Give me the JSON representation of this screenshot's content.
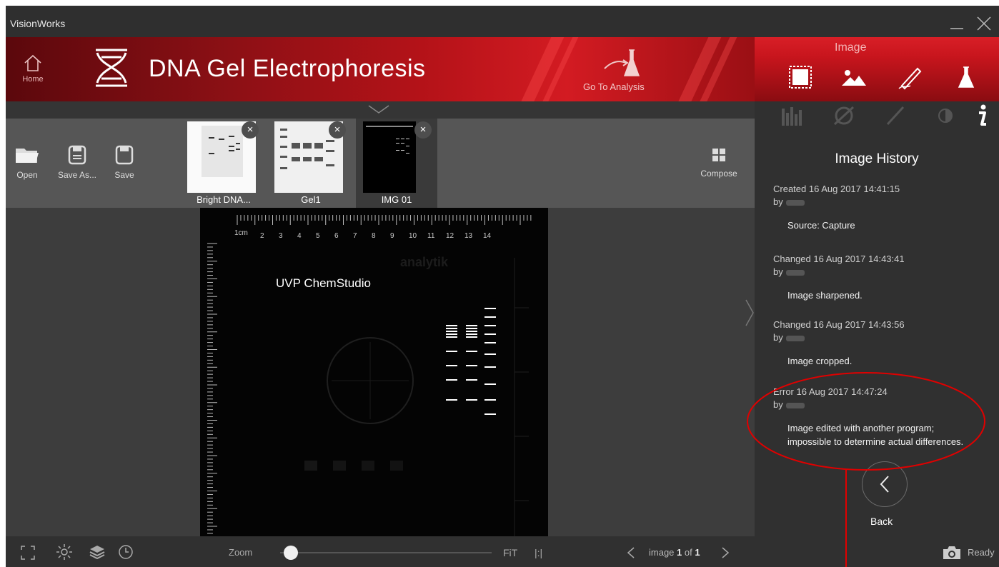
{
  "window": {
    "title": "VisionWorks"
  },
  "header": {
    "home_label": "Home",
    "app_title": "DNA Gel Electrophoresis",
    "go_to_analysis": "Go To Analysis",
    "image_section": "Image"
  },
  "toolbar": {
    "open": "Open",
    "save_as": "Save As...",
    "save": "Save",
    "compose": "Compose"
  },
  "thumbnails": [
    {
      "label": "Bright DNA..."
    },
    {
      "label": "Gel1"
    },
    {
      "label": "IMG 01"
    }
  ],
  "gel": {
    "label": "UVP ChemStudio",
    "watermark": "analytik",
    "ruler_unit": "1cm",
    "ruler_numbers": [
      "2",
      "3",
      "4",
      "5",
      "6",
      "7",
      "8",
      "9",
      "10",
      "11",
      "12",
      "13",
      "14"
    ]
  },
  "history": {
    "title": "Image History",
    "by": "by",
    "entries": [
      {
        "event": "Created 16 Aug 2017 14:41:15",
        "message": "Source: Capture"
      },
      {
        "event": "Changed 16 Aug 2017 14:43:41",
        "message": "Image sharpened."
      },
      {
        "event": "Changed 16 Aug 2017 14:43:56",
        "message": "Image cropped."
      },
      {
        "event": "Error 16 Aug 2017 14:47:24",
        "message_line1": "Image edited with another program;",
        "message_line2": "impossible to determine actual differences."
      }
    ],
    "back": "Back"
  },
  "statusbar": {
    "zoom": "Zoom",
    "zoom_level": 0.05,
    "fit": "FiT",
    "one_to_one": "|:|",
    "image_prefix": "image",
    "image_current": "1",
    "image_of": "of",
    "image_total": "1",
    "status": "Ready"
  },
  "colors": {
    "accent_red": "#c8151d",
    "panel_bg": "#303030",
    "annotation": "#e00000"
  }
}
